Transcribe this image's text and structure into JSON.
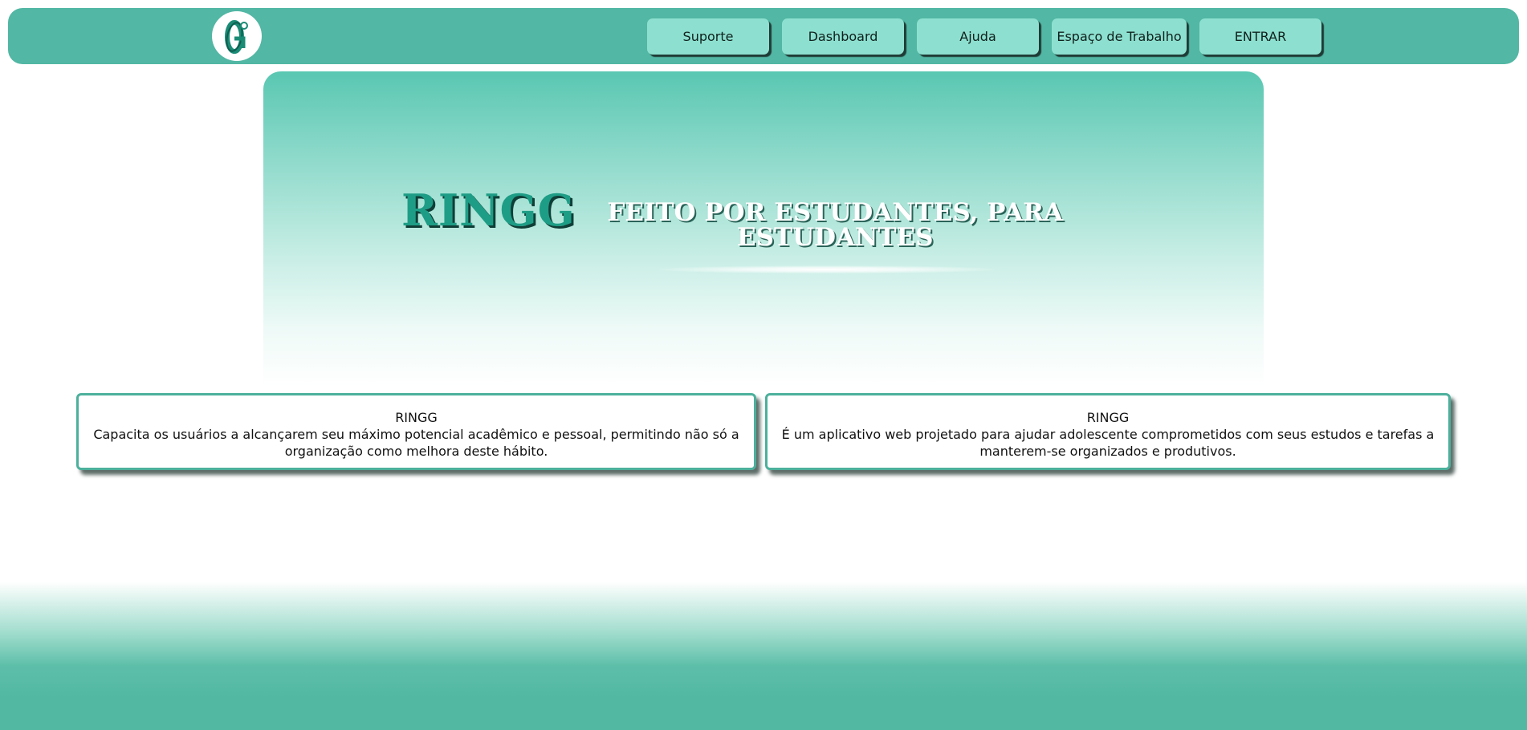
{
  "header": {
    "nav": [
      {
        "label": "Suporte"
      },
      {
        "label": "Dashboard"
      },
      {
        "label": "Ajuda"
      },
      {
        "label": "Espaço de Trabalho"
      },
      {
        "label": "ENTRAR"
      }
    ]
  },
  "hero": {
    "brand": "RINGG",
    "tagline": "FEITO POR ESTUDANTES, PARA ESTUDANTES"
  },
  "cards": [
    {
      "title": "RINGG",
      "text": "Capacita os usuários a alcançarem seu máximo potencial acadêmico e pessoal, permitindo não só a organização como melhora deste hábito."
    },
    {
      "title": "RINGG",
      "text": "É um aplicativo web projetado para ajudar adolescente comprometidos com seus estudos e tarefas a manterem-se organizados e produtivos."
    }
  ],
  "colors": {
    "header_bg": "#52b7a4",
    "nav_button_bg": "#8de0cf",
    "brand": "#1e9d86",
    "card_border": "#4cb09c"
  },
  "icons": {
    "logo": "ringg-logo"
  }
}
